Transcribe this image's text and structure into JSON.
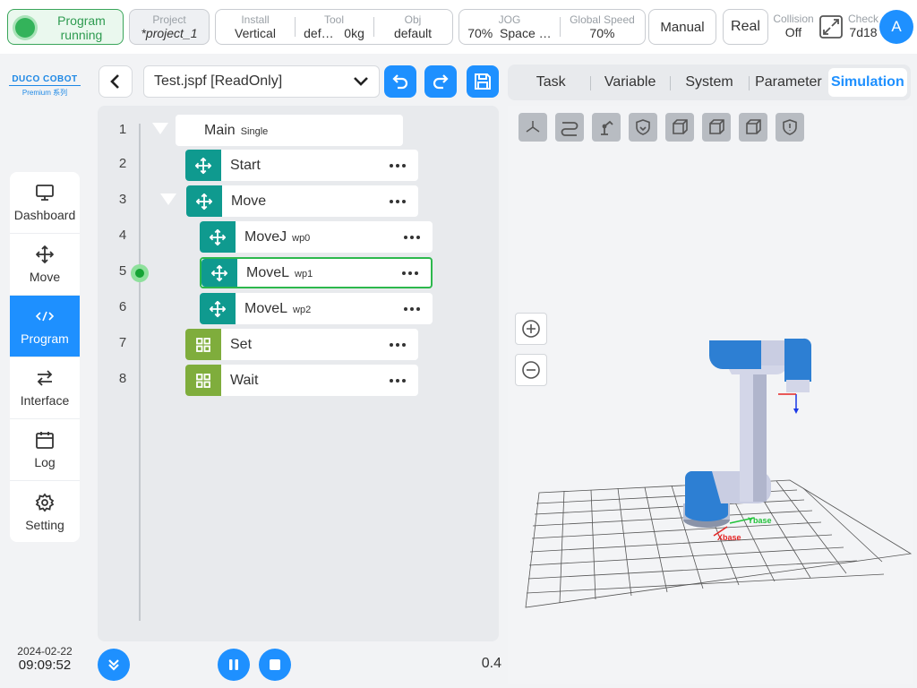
{
  "topbar": {
    "status": "Program running",
    "project": {
      "label": "Project",
      "value": "*project_1"
    },
    "install": {
      "label": "Install",
      "value": "Vertical"
    },
    "tool": {
      "label": "Tool",
      "value": "def…",
      "payload": "0kg"
    },
    "obj": {
      "label": "Obj",
      "value": "default"
    },
    "jog": {
      "label": "JOG",
      "value": "70%",
      "space": "Space …"
    },
    "global_speed": {
      "label": "Global Speed",
      "value": "70%"
    },
    "mode": "Manual",
    "run_target": "Real",
    "collision": {
      "label": "Collision",
      "value": "Off"
    },
    "check": {
      "label": "Check",
      "value": "7d18"
    },
    "avatar": "A"
  },
  "sidebar": {
    "logo": {
      "main": "DUCO COBOT",
      "sub": "Premium 系列"
    },
    "items": [
      {
        "label": "Dashboard",
        "icon": "monitor-icon"
      },
      {
        "label": "Move",
        "icon": "move-icon"
      },
      {
        "label": "Program",
        "icon": "code-icon",
        "active": true
      },
      {
        "label": "Interface",
        "icon": "swap-icon"
      },
      {
        "label": "Log",
        "icon": "calendar-icon"
      },
      {
        "label": "Setting",
        "icon": "gear-icon"
      }
    ],
    "date": "2024-02-22",
    "time": "09:09:52"
  },
  "program": {
    "file": "Test.jspf [ReadOnly]",
    "line_numbers": [
      "1",
      "2",
      "3",
      "4",
      "5",
      "6",
      "7",
      "8"
    ],
    "nodes": [
      {
        "name": "Main",
        "sub": "Single"
      },
      {
        "name": "Start",
        "sub": ""
      },
      {
        "name": "Move",
        "sub": ""
      },
      {
        "name": "MoveJ",
        "sub": "wp0"
      },
      {
        "name": "MoveL",
        "sub": "wp1",
        "selected": true
      },
      {
        "name": "MoveL",
        "sub": "wp2"
      },
      {
        "name": "Set",
        "sub": ""
      },
      {
        "name": "Wait",
        "sub": ""
      }
    ],
    "version": "0.4"
  },
  "right_panel": {
    "tabs": [
      "Task",
      "Variable",
      "System",
      "Parameter",
      "Simulation"
    ],
    "active_tab": "Simulation",
    "axis_labels": {
      "x": "Xbase",
      "y": "Ybase"
    }
  },
  "colors": {
    "accent": "#1e90ff",
    "running": "#33b35a",
    "node_teal": "#0f9a8f",
    "node_olive": "#7fad3c",
    "robot_blue": "#2d7fd3"
  }
}
